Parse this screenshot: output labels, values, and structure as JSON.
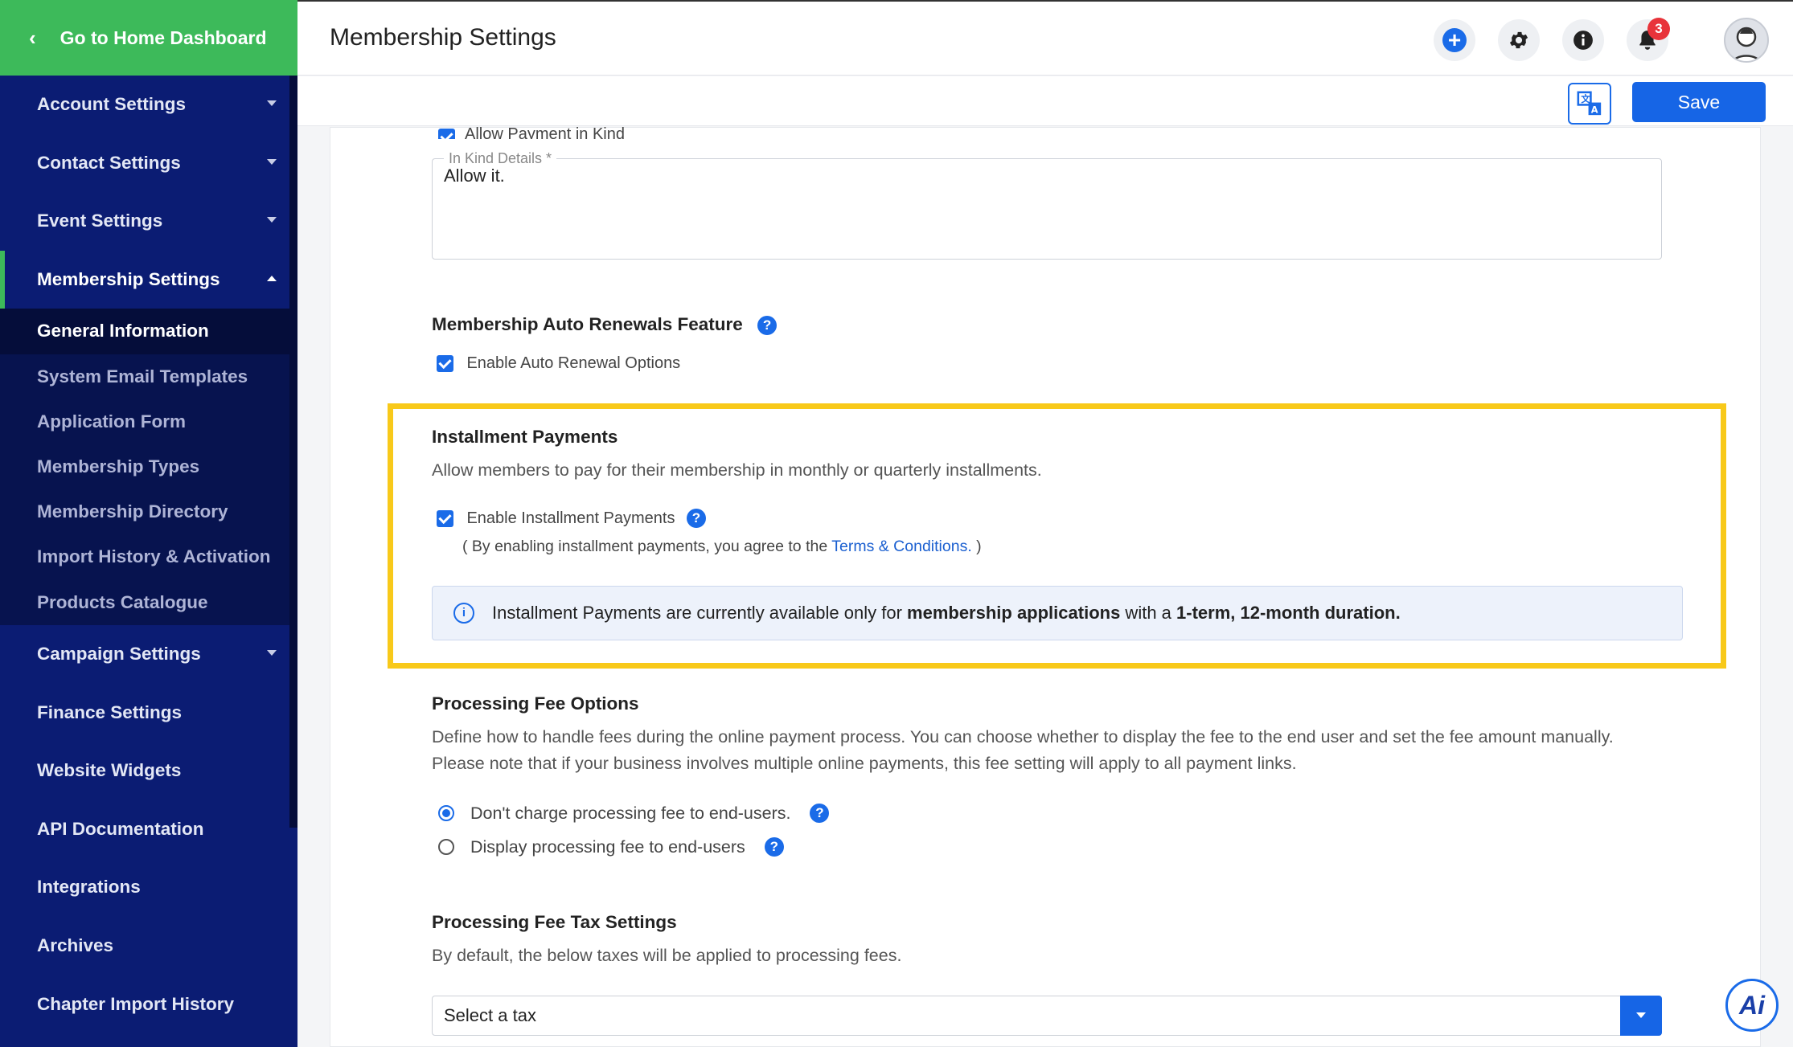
{
  "sidebar": {
    "home": "Go to Home Dashboard",
    "items": [
      {
        "label": "Account Settings"
      },
      {
        "label": "Contact Settings"
      },
      {
        "label": "Event Settings"
      },
      {
        "label": "Membership Settings"
      }
    ],
    "sub_items": [
      {
        "label": "General Information"
      },
      {
        "label": "System Email Templates"
      },
      {
        "label": "Application Form"
      },
      {
        "label": "Membership Types"
      },
      {
        "label": "Membership Directory"
      },
      {
        "label": "Import History & Activation"
      },
      {
        "label": "Products Catalogue"
      }
    ],
    "items_after": [
      {
        "label": "Campaign Settings"
      },
      {
        "label": "Finance Settings"
      },
      {
        "label": "Website Widgets"
      },
      {
        "label": "API Documentation"
      },
      {
        "label": "Integrations"
      },
      {
        "label": "Archives"
      },
      {
        "label": "Chapter Import History"
      }
    ]
  },
  "header": {
    "title": "Membership Settings",
    "notification_count": "3"
  },
  "toolbar": {
    "save_label": "Save"
  },
  "form": {
    "payment_in_kind_label": "Allow Payment in Kind",
    "in_kind_legend": "In Kind Details *",
    "in_kind_value": "Allow it.",
    "auto_renew_heading": "Membership Auto Renewals Feature",
    "auto_renew_checkbox": "Enable Auto Renewal Options",
    "installment_heading": "Installment Payments",
    "installment_desc": "Allow members to pay for their membership in monthly or quarterly installments.",
    "installment_checkbox": "Enable Installment Payments",
    "terms_prefix": "( By enabling installment payments, you agree to the ",
    "terms_link": "Terms & Conditions.",
    "terms_suffix": " )",
    "notice_prefix": "Installment Payments are currently available only for ",
    "notice_bold1": "membership applications",
    "notice_mid": " with a ",
    "notice_bold2": "1-term, 12-month duration.",
    "processing_heading": "Processing Fee Options",
    "processing_desc": "Define how to handle fees during the online payment process. You can choose whether to display the fee to the end user and set the fee amount manually. Please note that if your business involves multiple online payments, this fee setting will apply to all payment links.",
    "radio1": "Don't charge processing fee to end-users.",
    "radio2": "Display processing fee to end-users",
    "tax_heading": "Processing Fee Tax Settings",
    "tax_desc": "By default, the below taxes will be applied to processing fees.",
    "tax_select_value": "Select a tax"
  },
  "colors": {
    "sidebar_bg": "#0b1c73",
    "home_green": "#3dba5a",
    "accent_blue": "#1a6be8",
    "highlight_yellow": "#f8c91a",
    "badge_red": "#e8333a"
  }
}
